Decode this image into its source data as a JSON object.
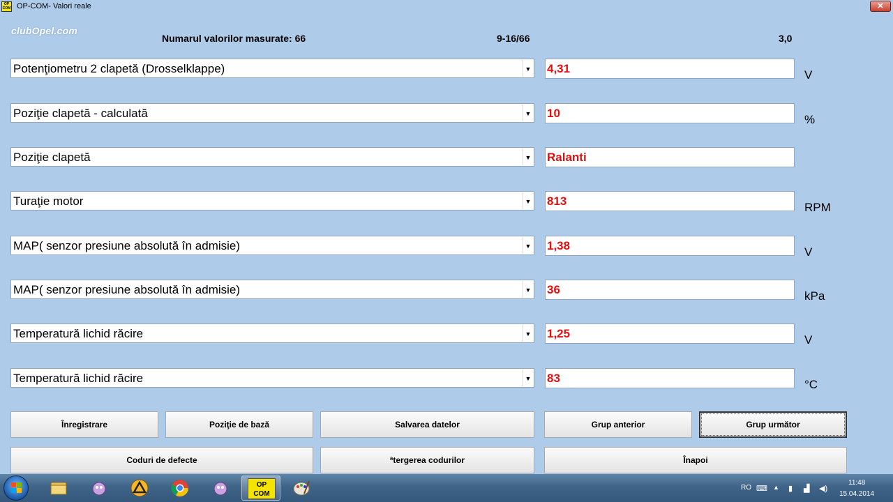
{
  "window": {
    "title": "OP-COM- Valori reale",
    "app_icon_text": "OP COM",
    "close_label": "✕"
  },
  "logo": {
    "text": "clubOpel.com"
  },
  "header": {
    "count_label": "Numarul valorilor masurate: 66",
    "range": "9-16/66",
    "version": "3,0"
  },
  "rows": [
    {
      "parameter": "Potenţiometru 2 clapetă (Drosselklappe)",
      "value": "4,31",
      "unit": "V"
    },
    {
      "parameter": "Poziţie clapetă - calculată",
      "value": "10",
      "unit": "%"
    },
    {
      "parameter": "Poziţie clapetă",
      "value": "Ralanti",
      "unit": ""
    },
    {
      "parameter": "Turaţie motor",
      "value": "813",
      "unit": "RPM"
    },
    {
      "parameter": "MAP( senzor presiune absolută în admisie)",
      "value": "1,38",
      "unit": "V"
    },
    {
      "parameter": "MAP( senzor presiune absolută în admisie)",
      "value": "36",
      "unit": "kPa"
    },
    {
      "parameter": "Temperatură lichid răcire",
      "value": "1,25",
      "unit": "V"
    },
    {
      "parameter": "Temperatură lichid răcire",
      "value": "83",
      "unit": "°C"
    }
  ],
  "dropdown_arrow": "▼",
  "buttons": {
    "record": "Înregistrare",
    "base_position": "Poziţie de bază",
    "save_data": "Salvarea datelor",
    "prev_group": "Grup anterior",
    "next_group": "Grup următor",
    "fault_codes": "Coduri de defecte",
    "clear_codes": "ªtergerea codurilor",
    "back": "Înapoi"
  },
  "taskbar": {
    "opcom_label_1": "OP",
    "opcom_label_2": "COM",
    "language": "RO",
    "time": "11:48",
    "date": "15.04.2014"
  },
  "colors": {
    "background": "#aecbea",
    "value_text": "#e01010"
  }
}
